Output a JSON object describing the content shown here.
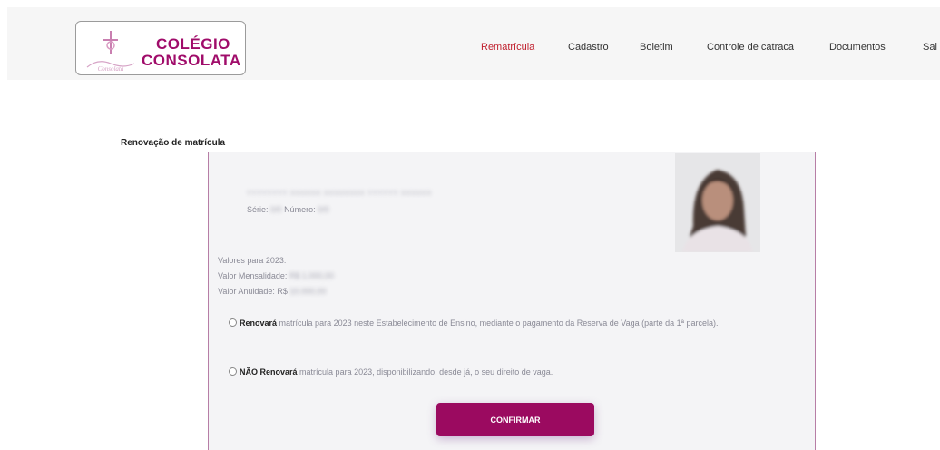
{
  "brand": {
    "line1": "COLÉGIO",
    "line2": "CONSOLATA",
    "color": "#a00c6a"
  },
  "nav": {
    "items": [
      {
        "label": "Rematrícula",
        "active": true
      },
      {
        "label": "Cadastro",
        "active": false
      },
      {
        "label": "Boletim",
        "active": false
      },
      {
        "label": "Controle de catraca",
        "active": false
      },
      {
        "label": "Documentos",
        "active": false
      },
      {
        "label": "Sai",
        "active": false
      }
    ],
    "active_color": "#c0202e"
  },
  "page": {
    "title": "Renovação de matrícula"
  },
  "student": {
    "name": "YYYYYYYY XXXXXX XXXXXXXX YYYYYY XXXXXX",
    "serie_label": "Série:",
    "serie_value": "0/0",
    "numero_label": "Número:",
    "numero_value": "0/0",
    "photo_icon": "student-photo"
  },
  "values": {
    "heading": "Valores para 2023:",
    "mensalidade_label": "Valor Mensalidade:",
    "mensalidade_value": "R$ 1.000,00",
    "anuidade_label": "Valor Anuidade: R$",
    "anuidade_value": "10.000,00"
  },
  "options": {
    "renew_bold": "Renovará",
    "renew_text": "matrícula para 2023 neste Estabelecimento de Ensino, mediante o pagamento da Reserva de Vaga (parte da 1ª parcela).",
    "not_renew_bold": "NÃO Renovará",
    "not_renew_text": "matrícula para 2023, disponibilizando, desde já, o seu direito de vaga."
  },
  "actions": {
    "confirm_label": "CONFIRMAR",
    "confirm_color": "#9b0a60"
  }
}
